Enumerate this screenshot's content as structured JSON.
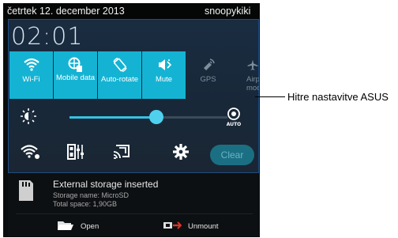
{
  "statusbar": {
    "date": "četrtek 12. december 2013",
    "user": "snoopykiki"
  },
  "panel": {
    "clock": "02:01"
  },
  "quick_settings": [
    {
      "label": "Wi-Fi",
      "icon": "wifi-icon",
      "active": true
    },
    {
      "label": "Mobile data",
      "icon": "mobile-data-icon",
      "active": true
    },
    {
      "label": "Auto-rotate",
      "icon": "auto-rotate-icon",
      "active": true
    },
    {
      "label": "Mute",
      "icon": "mute-icon",
      "active": true
    },
    {
      "label": "GPS",
      "icon": "gps-icon",
      "active": false
    },
    {
      "label": "Airplane mode",
      "icon": "airplane-icon",
      "active": false
    }
  ],
  "brightness": {
    "level": 0.55,
    "auto_label": "AUTO"
  },
  "bottom_row": {
    "clear_label": "Clear"
  },
  "notification": {
    "title": "External storage inserted",
    "line1": "Storage name: MicroSD",
    "line2": "Total space: 1,90GB",
    "open_label": "Open",
    "unmount_label": "Unmount"
  },
  "callout": {
    "text": "Hitre nastavitve ASUS"
  },
  "colors": {
    "accent": "#15b3d3",
    "panel_bg": "#1a2c40",
    "border": "#1f4f86"
  }
}
